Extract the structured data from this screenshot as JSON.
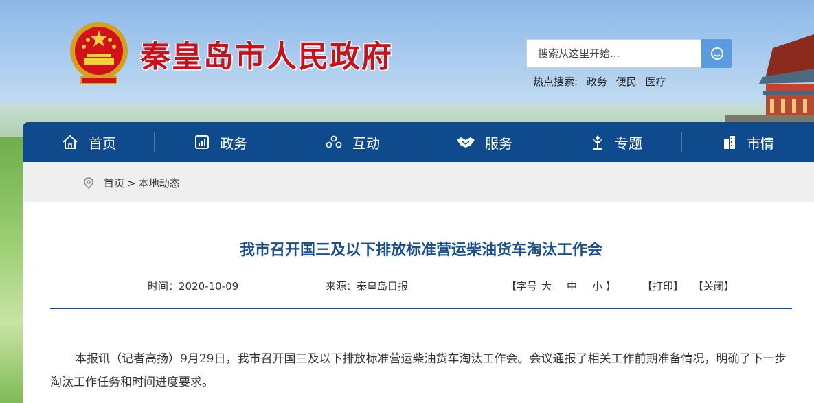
{
  "header": {
    "site_title": "秦皇岛市人民政府",
    "search_placeholder": "搜索从这里开始...",
    "hot_label": "热点搜索:",
    "hot_terms": [
      "政务",
      "便民",
      "医疗"
    ]
  },
  "nav": [
    {
      "label": "首页",
      "icon": "home-icon"
    },
    {
      "label": "政务",
      "icon": "chart-icon"
    },
    {
      "label": "互动",
      "icon": "people-icon"
    },
    {
      "label": "服务",
      "icon": "handshake-icon"
    },
    {
      "label": "专题",
      "icon": "flower-icon"
    },
    {
      "label": "市情",
      "icon": "building-icon"
    }
  ],
  "breadcrumb": {
    "home": "首页",
    "separator": ">",
    "current": "本地动态"
  },
  "article": {
    "title": "我市召开国三及以下排放标准营运柴油货车淘汰工作会",
    "time": "时间：2020-10-09",
    "source": "来源：秦皇岛日报",
    "font_size_label": "【字号",
    "font_large": "大",
    "font_medium": "中",
    "font_small": "小 】",
    "print": "【打印】",
    "close": "【关闭】",
    "body": "本报讯（记者高扬）9月29日，我市召开国三及以下排放标准营运柴油货车淘汰工作会。会议通报了相关工作前期准备情况，明确了下一步淘汰工作任务和时间进度要求。"
  },
  "colors": {
    "nav_bg": "#0f4a8c",
    "title_red": "#c8111b",
    "article_title": "#1a4f8e"
  }
}
